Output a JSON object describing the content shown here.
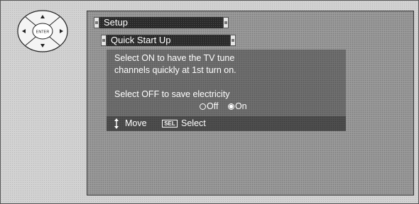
{
  "remote": {
    "center_label": "ENTER"
  },
  "menu": {
    "title": "Setup",
    "submenu": "Quick Start Up"
  },
  "message": {
    "line1": "Select ON to have the TV tune",
    "line2": "channels quickly at 1st turn on.",
    "line3": "Select OFF to save electricity"
  },
  "options": [
    {
      "label": "Off",
      "selected": false
    },
    {
      "label": "On",
      "selected": true
    }
  ],
  "help": {
    "move_label": "Move",
    "sel_key": "SEL",
    "select_label": "Select"
  },
  "icons": {
    "remote": "dpad-remote-icon",
    "move": "up-down-arrows-icon",
    "radio": "radio-button-icon"
  }
}
